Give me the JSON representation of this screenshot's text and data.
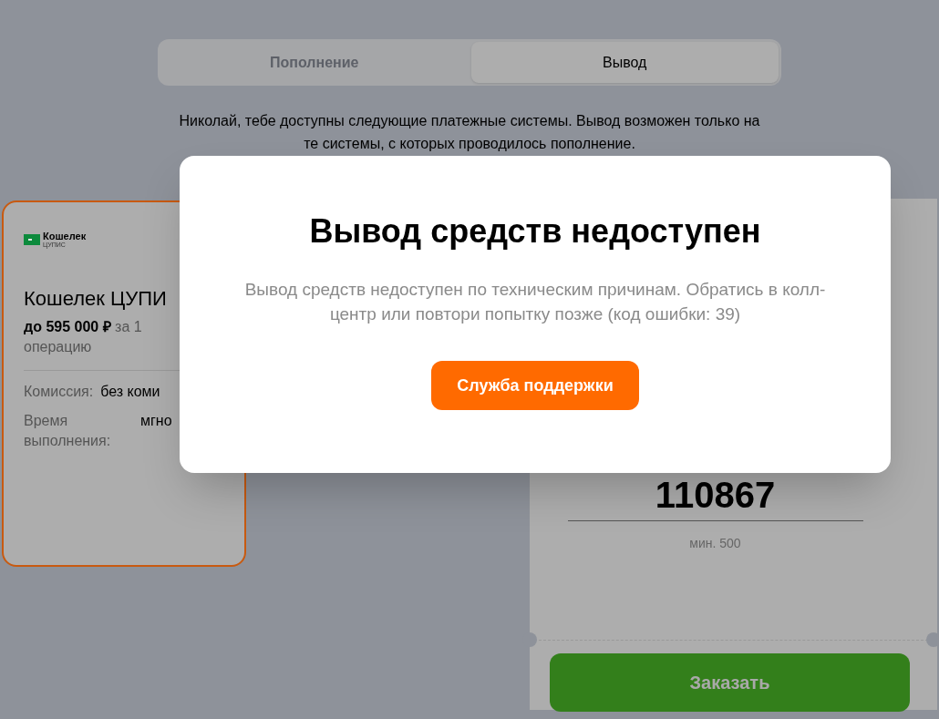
{
  "tabs": [
    {
      "label": "Пополнение",
      "selected": false
    },
    {
      "label": "Вывод",
      "selected": true
    }
  ],
  "notice": "Николай, тебе доступны следующие платежные системы. Вывод возможен только на те системы, с которых проводилось пополнение.",
  "payment_card": {
    "selected": true,
    "logo_text": "Кошелек",
    "logo_subtext": "ЦУПИС",
    "title": "Кошелек ЦУПИ",
    "limit": "до 595 000 ₽",
    "limit_suffix": "за 1 операцию",
    "details": [
      {
        "label": "Комиссия:",
        "value": "без коми"
      },
      {
        "label": "Время выполнения:",
        "value": "мгно"
      }
    ]
  },
  "amount_panel": {
    "amount": "110867",
    "hint": "мин. 500",
    "order_button": "Заказать"
  },
  "modal": {
    "title": "Вывод средств недоступен",
    "message": "Вывод средств недоступен по техническим причинам. Обратись в колл-центр или повтори попытку позже (код ошибки: 39)",
    "button": "Служба поддержки"
  }
}
